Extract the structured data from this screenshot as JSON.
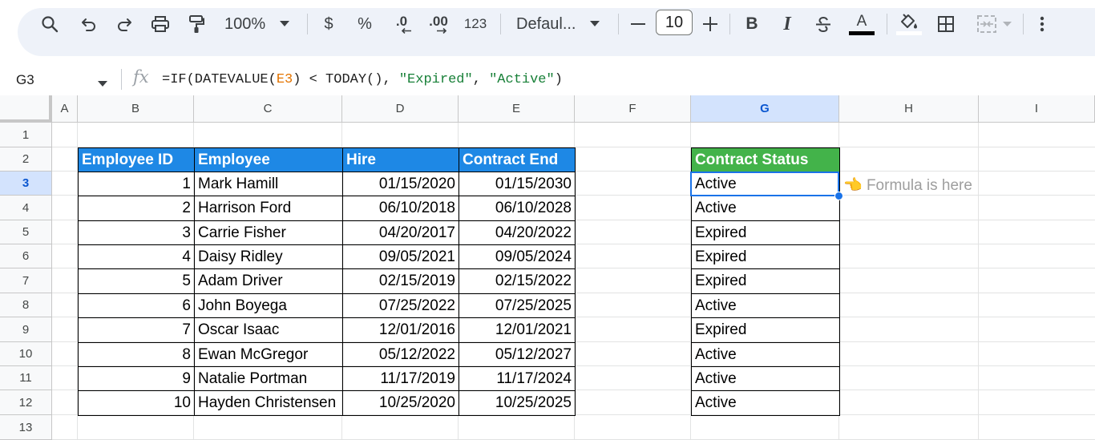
{
  "toolbar": {
    "zoom": "100%",
    "currency_label": "$",
    "percent_label": "%",
    "dec_decrease_label": ".0",
    "dec_increase_label": ".00",
    "more_formats_label": "123",
    "font_family": "Defaul...",
    "font_size": "10",
    "text_color": "#000000"
  },
  "formula_bar": {
    "cell_ref": "G3",
    "formula_prefix": "=IF(DATEVALUE(",
    "formula_ref": "E3",
    "formula_mid": ") < TODAY(), ",
    "formula_str1": "\"Expired\"",
    "formula_sep": ", ",
    "formula_str2": "\"Active\"",
    "formula_end": ")"
  },
  "columns": [
    "A",
    "B",
    "C",
    "D",
    "E",
    "F",
    "G",
    "H",
    "I"
  ],
  "rows": [
    "1",
    "2",
    "3",
    "4",
    "5",
    "6",
    "7",
    "8",
    "9",
    "10",
    "11",
    "12",
    "13"
  ],
  "selected_cell": "G3",
  "table": {
    "headers": [
      "Employee ID",
      "Employee",
      "Hire",
      "Contract End"
    ],
    "header_color": "#1e88e5",
    "rows": [
      [
        "1",
        "Mark Hamill",
        "01/15/2020",
        "01/15/2030"
      ],
      [
        "2",
        "Harrison Ford",
        "06/10/2018",
        "06/10/2028"
      ],
      [
        "3",
        "Carrie Fisher",
        "04/20/2017",
        "04/20/2022"
      ],
      [
        "4",
        "Daisy Ridley",
        "09/05/2021",
        "09/05/2024"
      ],
      [
        "5",
        "Adam Driver",
        "02/15/2019",
        "02/15/2022"
      ],
      [
        "6",
        "John Boyega",
        "07/25/2022",
        "07/25/2025"
      ],
      [
        "7",
        "Oscar Isaac",
        "12/01/2016",
        "12/01/2021"
      ],
      [
        "8",
        "Ewan McGregor",
        "05/12/2022",
        "05/12/2027"
      ],
      [
        "9",
        "Natalie Portman",
        "11/17/2019",
        "11/17/2024"
      ],
      [
        "10",
        "Hayden Christensen",
        "10/25/2020",
        "10/25/2025"
      ]
    ]
  },
  "status": {
    "header": "Contract Status",
    "header_color": "#43b34a",
    "values": [
      "Active",
      "Active",
      "Expired",
      "Expired",
      "Expired",
      "Active",
      "Expired",
      "Active",
      "Active",
      "Active"
    ]
  },
  "note": {
    "icon": "pointing-hand-icon",
    "emoji": "👈",
    "text": "Formula is here"
  }
}
